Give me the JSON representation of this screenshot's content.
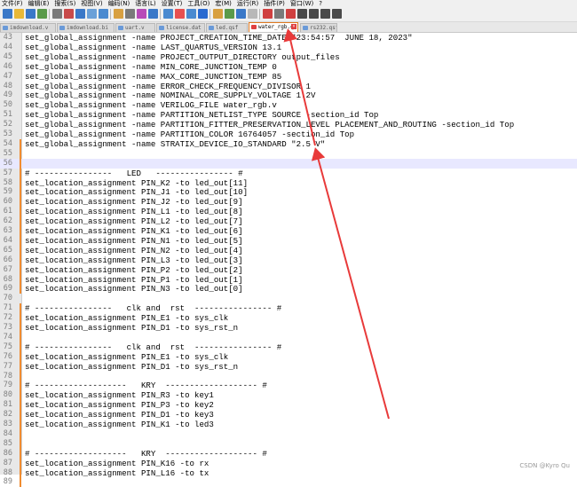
{
  "menu": [
    "文件(F)",
    "编辑(E)",
    "搜索(S)",
    "视图(V)",
    "编码(N)",
    "语言(L)",
    "设置(T)",
    "工具(O)",
    "宏(M)",
    "运行(R)",
    "插件(P)",
    "窗口(W)",
    "?"
  ],
  "tabs": [
    {
      "label": "imdownload.v",
      "active": false
    },
    {
      "label": "imdownload.bi",
      "active": false
    },
    {
      "label": "uart.v",
      "active": false
    },
    {
      "label": "license.dat",
      "active": false
    },
    {
      "label": "led.qsf",
      "active": false
    },
    {
      "label": "water_rgb.qsf",
      "active": true
    },
    {
      "label": "rs232.qsf",
      "active": false
    }
  ],
  "lines": [
    {
      "n": "43",
      "t": "set_global_assignment -name PROJECT_CREATION_TIME_DATE \"23:54:57  JUNE 18, 2023\"",
      "mark": false
    },
    {
      "n": "44",
      "t": "set_global_assignment -name LAST_QUARTUS_VERSION 13.1",
      "mark": false
    },
    {
      "n": "45",
      "t": "set_global_assignment -name PROJECT_OUTPUT_DIRECTORY output_files",
      "mark": false
    },
    {
      "n": "46",
      "t": "set_global_assignment -name MIN_CORE_JUNCTION_TEMP 0",
      "mark": false
    },
    {
      "n": "47",
      "t": "set_global_assignment -name MAX_CORE_JUNCTION_TEMP 85",
      "mark": false
    },
    {
      "n": "48",
      "t": "set_global_assignment -name ERROR_CHECK_FREQUENCY_DIVISOR 1",
      "mark": false
    },
    {
      "n": "49",
      "t": "set_global_assignment -name NOMINAL_CORE_SUPPLY_VOLTAGE 1.2V",
      "mark": false
    },
    {
      "n": "50",
      "t": "set_global_assignment -name VERILOG_FILE water_rgb.v",
      "mark": false
    },
    {
      "n": "51",
      "t": "set_global_assignment -name PARTITION_NETLIST_TYPE SOURCE -section_id Top",
      "mark": false
    },
    {
      "n": "52",
      "t": "set_global_assignment -name PARTITION_FITTER_PRESERVATION_LEVEL PLACEMENT_AND_ROUTING -section_id Top",
      "mark": false
    },
    {
      "n": "53",
      "t": "set_global_assignment -name PARTITION_COLOR 16764057 -section_id Top",
      "mark": false
    },
    {
      "n": "54",
      "t": "set_global_assignment -name STRATIX_DEVICE_IO_STANDARD \"2.5 V\"",
      "mark": true
    },
    {
      "n": "55",
      "t": "",
      "mark": true
    },
    {
      "n": "56",
      "t": "",
      "mark": true,
      "current": true
    },
    {
      "n": "57",
      "t": "# ----------------   LED   ---------------- #",
      "mark": true
    },
    {
      "n": "58",
      "t": "set_location_assignment PIN_K2 -to led_out[11]",
      "mark": true
    },
    {
      "n": "59",
      "t": "set_location_assignment PIN_J1 -to led_out[10]",
      "mark": true
    },
    {
      "n": "60",
      "t": "set_location_assignment PIN_J2 -to led_out[9]",
      "mark": true
    },
    {
      "n": "61",
      "t": "set_location_assignment PIN_L1 -to led_out[8]",
      "mark": true
    },
    {
      "n": "62",
      "t": "set_location_assignment PIN_L2 -to led_out[7]",
      "mark": true
    },
    {
      "n": "63",
      "t": "set_location_assignment PIN_K1 -to led_out[6]",
      "mark": true
    },
    {
      "n": "64",
      "t": "set_location_assignment PIN_N1 -to led_out[5]",
      "mark": true
    },
    {
      "n": "65",
      "t": "set_location_assignment PIN_N2 -to led_out[4]",
      "mark": true
    },
    {
      "n": "66",
      "t": "set_location_assignment PIN_L3 -to led_out[3]",
      "mark": true
    },
    {
      "n": "67",
      "t": "set_location_assignment PIN_P2 -to led_out[2]",
      "mark": true
    },
    {
      "n": "68",
      "t": "set_location_assignment PIN_P1 -to led_out[1]",
      "mark": true
    },
    {
      "n": "69",
      "t": "set_location_assignment PIN_N3 -to led_out[0]",
      "mark": true
    },
    {
      "n": "70",
      "t": "",
      "mark": false
    },
    {
      "n": "71",
      "t": "# ----------------   clk and  rst  ---------------- #",
      "mark": true
    },
    {
      "n": "72",
      "t": "set_location_assignment PIN_E1 -to sys_clk",
      "mark": true
    },
    {
      "n": "73",
      "t": "set_location_assignment PIN_D1 -to sys_rst_n",
      "mark": true
    },
    {
      "n": "74",
      "t": "",
      "mark": true
    },
    {
      "n": "75",
      "t": "# ----------------   clk and  rst  ---------------- #",
      "mark": true
    },
    {
      "n": "76",
      "t": "set_location_assignment PIN_E1 -to sys_clk",
      "mark": true
    },
    {
      "n": "77",
      "t": "set_location_assignment PIN_D1 -to sys_rst_n",
      "mark": true
    },
    {
      "n": "78",
      "t": "",
      "mark": true
    },
    {
      "n": "79",
      "t": "# -------------------   KRY  ------------------- #",
      "mark": true
    },
    {
      "n": "80",
      "t": "set_location_assignment PIN_R3 -to key1",
      "mark": true
    },
    {
      "n": "81",
      "t": "set_location_assignment PIN_P3 -to key2",
      "mark": true
    },
    {
      "n": "82",
      "t": "set_location_assignment PIN_D1 -to key3",
      "mark": true
    },
    {
      "n": "83",
      "t": "set_location_assignment PIN_K1 -to led3",
      "mark": true
    },
    {
      "n": "84",
      "t": "",
      "mark": true
    },
    {
      "n": "85",
      "t": "",
      "mark": true
    },
    {
      "n": "86",
      "t": "# -------------------   KRY  ------------------- #",
      "mark": true
    },
    {
      "n": "87",
      "t": "set_location_assignment PIN_K16 -to rx",
      "mark": true
    },
    {
      "n": "88",
      "t": "set_location_assignment PIN_L16 -to tx",
      "mark": true
    },
    {
      "n": "89",
      "t": "",
      "mark": true
    }
  ],
  "watermark": "CSDN @Kyro Qu",
  "colors": {
    "accent": "#f08c30",
    "arrow": "#e83a3a",
    "current_line": "#e8e8ff"
  }
}
